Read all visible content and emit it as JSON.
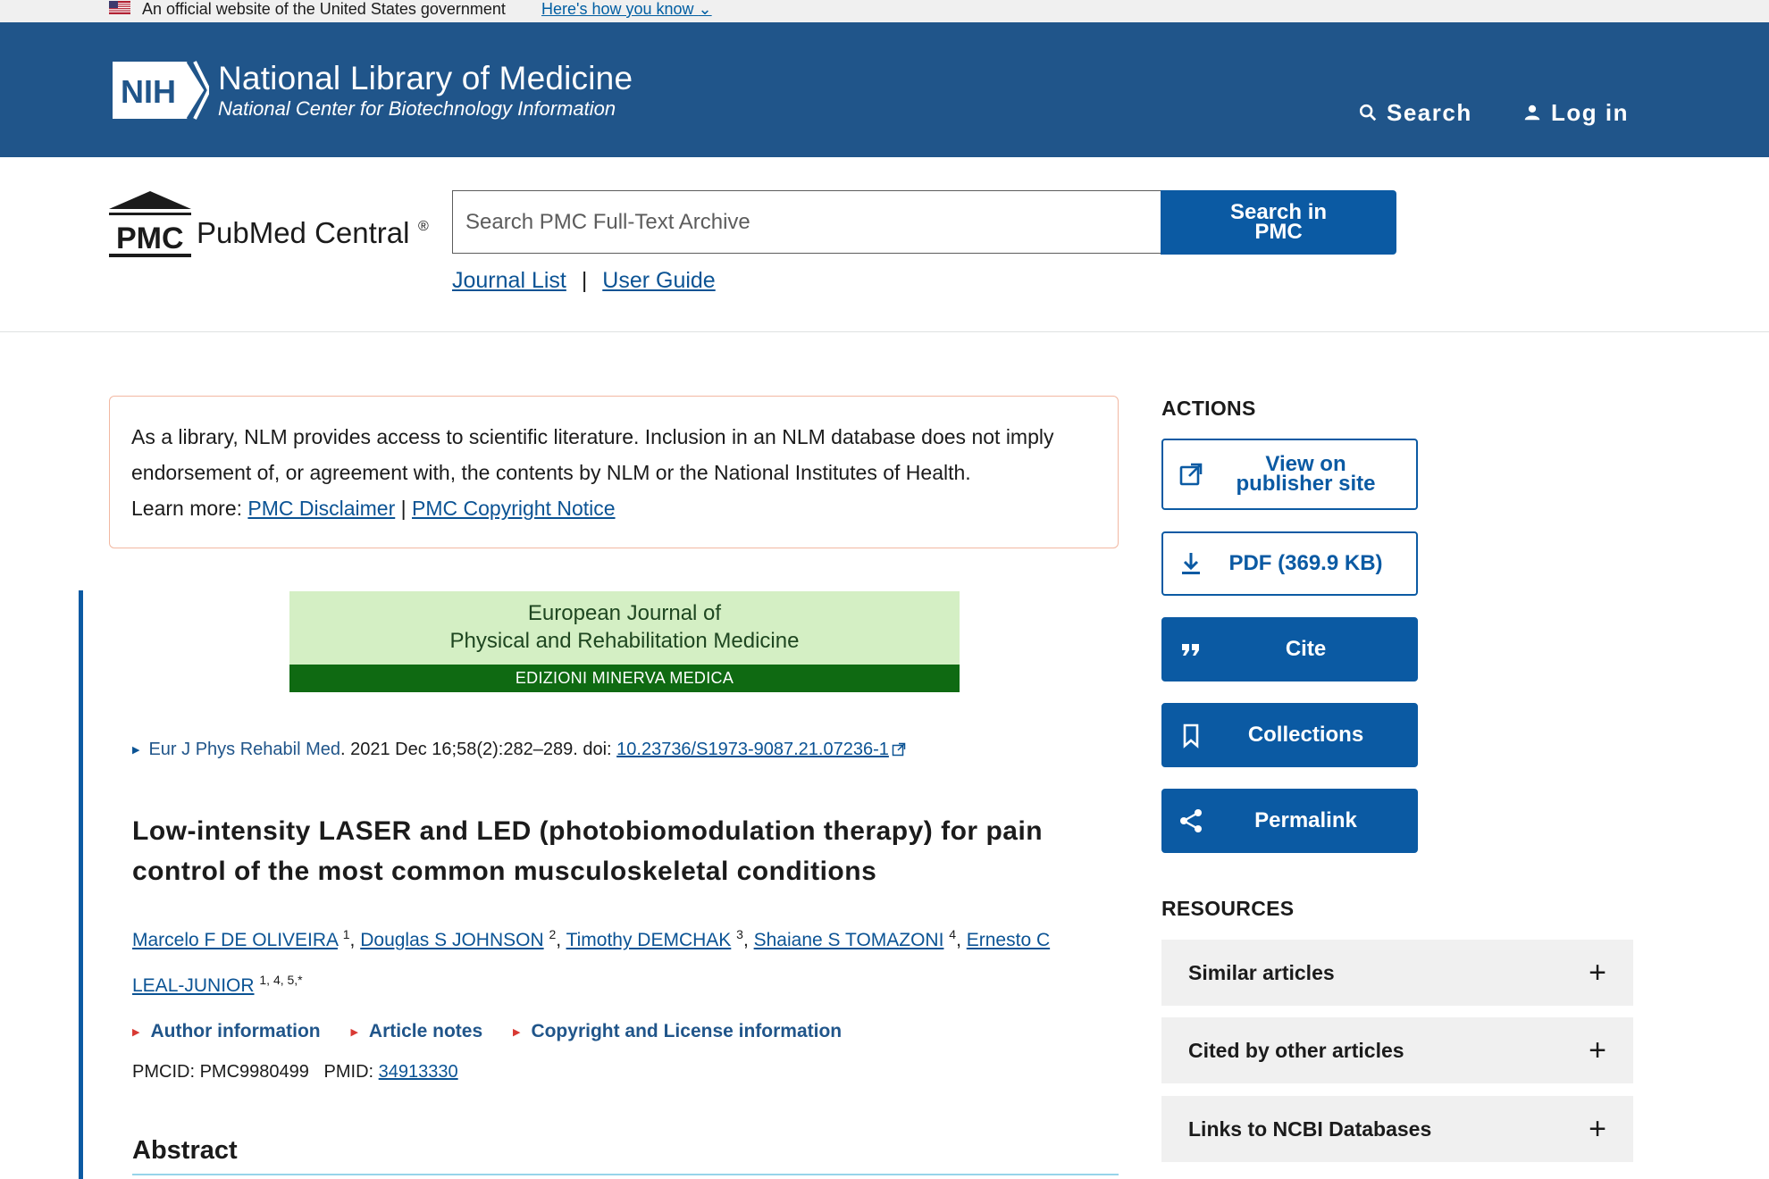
{
  "gov_banner": {
    "text": "An official website of the United States government",
    "link": "Here's how you know"
  },
  "nih_header": {
    "logo_text": "NIH",
    "title": "National Library of Medicine",
    "subtitle": "National Center for Biotechnology Information",
    "search_label": "Search",
    "login_label": "Log in"
  },
  "pmc_bar": {
    "logo_abbr": "PMC",
    "logo_name": "PubMed Central",
    "logo_mark": "®",
    "search_placeholder": "Search PMC Full-Text Archive",
    "search_button_line1": "Search in",
    "search_button_line2": "PMC",
    "journal_list": "Journal List",
    "separator": "|",
    "user_guide": "User Guide"
  },
  "disclaimer": {
    "text": "As a library, NLM provides access to scientific literature. Inclusion in an NLM database does not imply endorsement of, or agreement with, the contents by NLM or the National Institutes of Health.",
    "learn_more": "Learn more:",
    "link1": "PMC Disclaimer",
    "separator": "|",
    "link2": "PMC Copyright Notice"
  },
  "journal_banner": {
    "line1": "European Journal of",
    "line2": "Physical and Rehabilitation Medicine",
    "publisher": "EDIZIONI MINERVA MEDICA"
  },
  "citation": {
    "journal": "Eur J Phys Rehabil Med",
    "details": ". 2021 Dec 16;58(2):282–289. doi: ",
    "doi": "10.23736/S1973-9087.21.07236-1"
  },
  "article": {
    "title": "Low-intensity LASER and LED (photobiomodulation therapy) for pain control of the most common musculoskeletal conditions",
    "authors": [
      {
        "name": "Marcelo F DE OLIVEIRA",
        "sup": "1",
        "sep": ", "
      },
      {
        "name": "Douglas S JOHNSON",
        "sup": "2",
        "sep": ", "
      },
      {
        "name": "Timothy DEMCHAK",
        "sup": "3",
        "sep": ", "
      },
      {
        "name": "Shaiane S TOMAZONI",
        "sup": "4",
        "sep": ", "
      },
      {
        "name": "Ernesto C LEAL-JUNIOR",
        "sup": "1, 4, 5,*",
        "sep": ""
      }
    ],
    "info_links": [
      "Author information",
      "Article notes",
      "Copyright and License information"
    ],
    "pmcid_label": "PMCID: ",
    "pmcid": "PMC9980499",
    "pmid_label": "PMID: ",
    "pmid": "34913330",
    "abstract_heading": "Abstract"
  },
  "sidebar": {
    "actions_heading": "ACTIONS",
    "actions": {
      "publisher_line1": "View on",
      "publisher_line2": "publisher site",
      "pdf": "PDF (369.9 KB)",
      "cite": "Cite",
      "collections": "Collections",
      "permalink": "Permalink"
    },
    "resources_heading": "RESOURCES",
    "resources": [
      "Similar articles",
      "Cited by other articles",
      "Links to NCBI Databases"
    ],
    "plus": "+"
  },
  "colors": {
    "nih_blue": "#20558a",
    "pmc_blue": "#0b5aa3",
    "journal_green": "#0f6a12",
    "journal_light": "#d4efc4"
  }
}
